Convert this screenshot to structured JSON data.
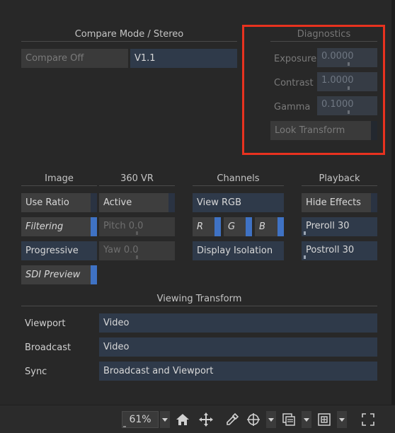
{
  "compare": {
    "title": "Compare Mode / Stereo",
    "mode": "Compare Off",
    "version": "V1.1"
  },
  "diagnostics": {
    "title": "Diagnostics",
    "exposure_label": "Exposure",
    "exposure_value": "0.0000",
    "contrast_label": "Contrast",
    "contrast_value": "1.0000",
    "gamma_label": "Gamma",
    "gamma_value": "0.1000",
    "look_transform": "Look Transform"
  },
  "image": {
    "title": "Image",
    "use_ratio": "Use Ratio",
    "filtering": "Filtering",
    "progressive": "Progressive",
    "sdi_preview": "SDI Preview"
  },
  "vr": {
    "title": "360 VR",
    "active": "Active",
    "pitch": "Pitch 0.0",
    "yaw": "Yaw 0.0"
  },
  "channels": {
    "title": "Channels",
    "view_rgb": "View RGB",
    "r": "R",
    "g": "G",
    "b": "B",
    "display_isolation": "Display Isolation"
  },
  "playback": {
    "title": "Playback",
    "hide_effects": "Hide Effects",
    "preroll": "Preroll 30",
    "postroll": "Postroll 30"
  },
  "viewing_transform": {
    "title": "Viewing Transform",
    "viewport_label": "Viewport",
    "viewport_value": "Video",
    "broadcast_label": "Broadcast",
    "broadcast_value": "Video",
    "sync_label": "Sync",
    "sync_value": "Broadcast and Viewport"
  },
  "toolbar": {
    "zoom": "61%",
    "icons": [
      "home-icon",
      "move-icon",
      "eyedropper-icon",
      "crosshair-icon",
      "layers-icon",
      "frame-icon",
      "fullscreen-icon"
    ]
  },
  "colors": {
    "accent": "#3f72c4",
    "highlight": "#e8321f",
    "background": "#282828"
  }
}
